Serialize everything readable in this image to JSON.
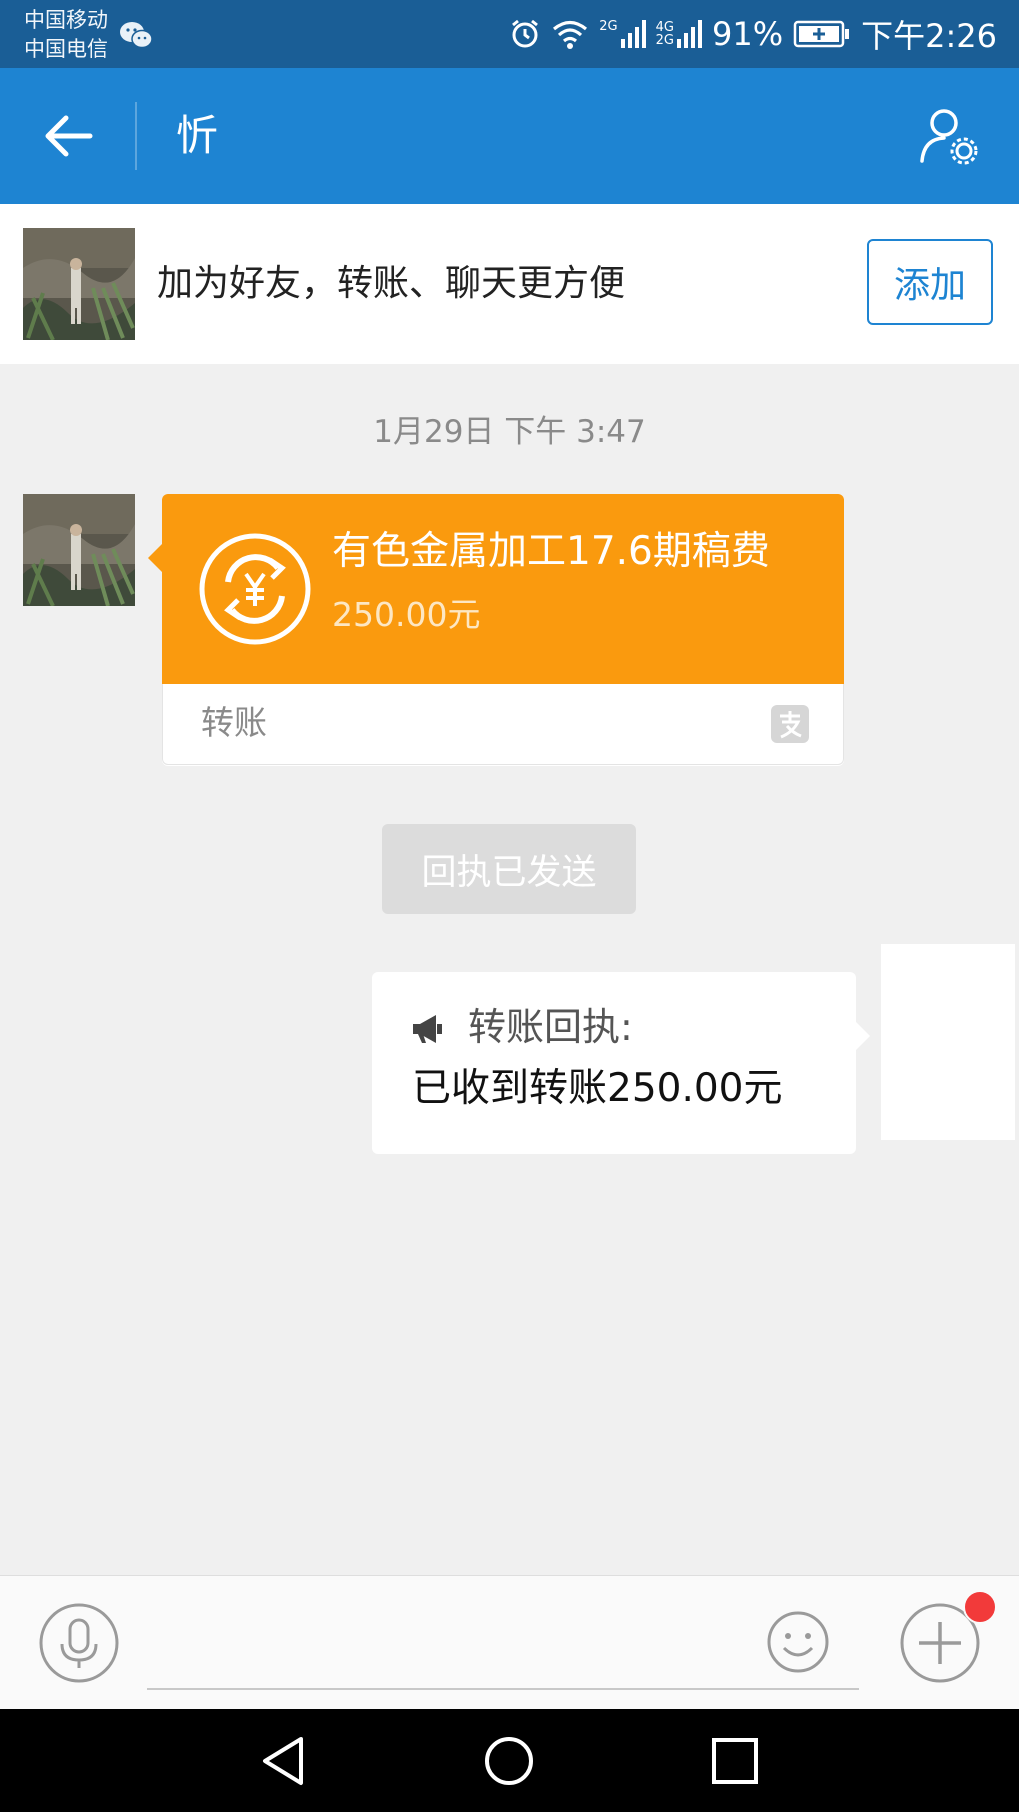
{
  "status_bar": {
    "carrier_1": "中国移动",
    "carrier_2": "中国电信",
    "net_1": "2G",
    "net_2a": "4G",
    "net_2b": "2G",
    "battery": "91%",
    "time": "下午2:26"
  },
  "header": {
    "title": "忻",
    "icons": {
      "back": "back-arrow-icon",
      "profile": "user-settings-icon"
    }
  },
  "add_friend_bar": {
    "text": "加为好友，转账、聊天更方便",
    "button_label": "添加"
  },
  "chat": {
    "timestamp": "1月29日 下午 3:47",
    "transfer": {
      "title": "有色金属加工17.6期稿费",
      "amount": "250.00元",
      "label": "转账",
      "icon": "yen-exchange-icon",
      "brand_icon": "alipay-icon"
    },
    "receipt_chip": "回执已发送",
    "reply": {
      "title": "转账回执:",
      "body": "已收到转账250.00元",
      "icon": "megaphone-icon"
    }
  },
  "input_bar": {
    "placeholder": "",
    "icons": {
      "voice": "microphone-icon",
      "emoji": "smiley-icon",
      "plus": "plus-icon"
    },
    "badge_color": "#f23a3a"
  },
  "colors": {
    "status_bar": "#1a5e96",
    "header": "#1e84d2",
    "transfer_orange": "#fa9a0e",
    "chat_background": "#f0f0f0"
  }
}
